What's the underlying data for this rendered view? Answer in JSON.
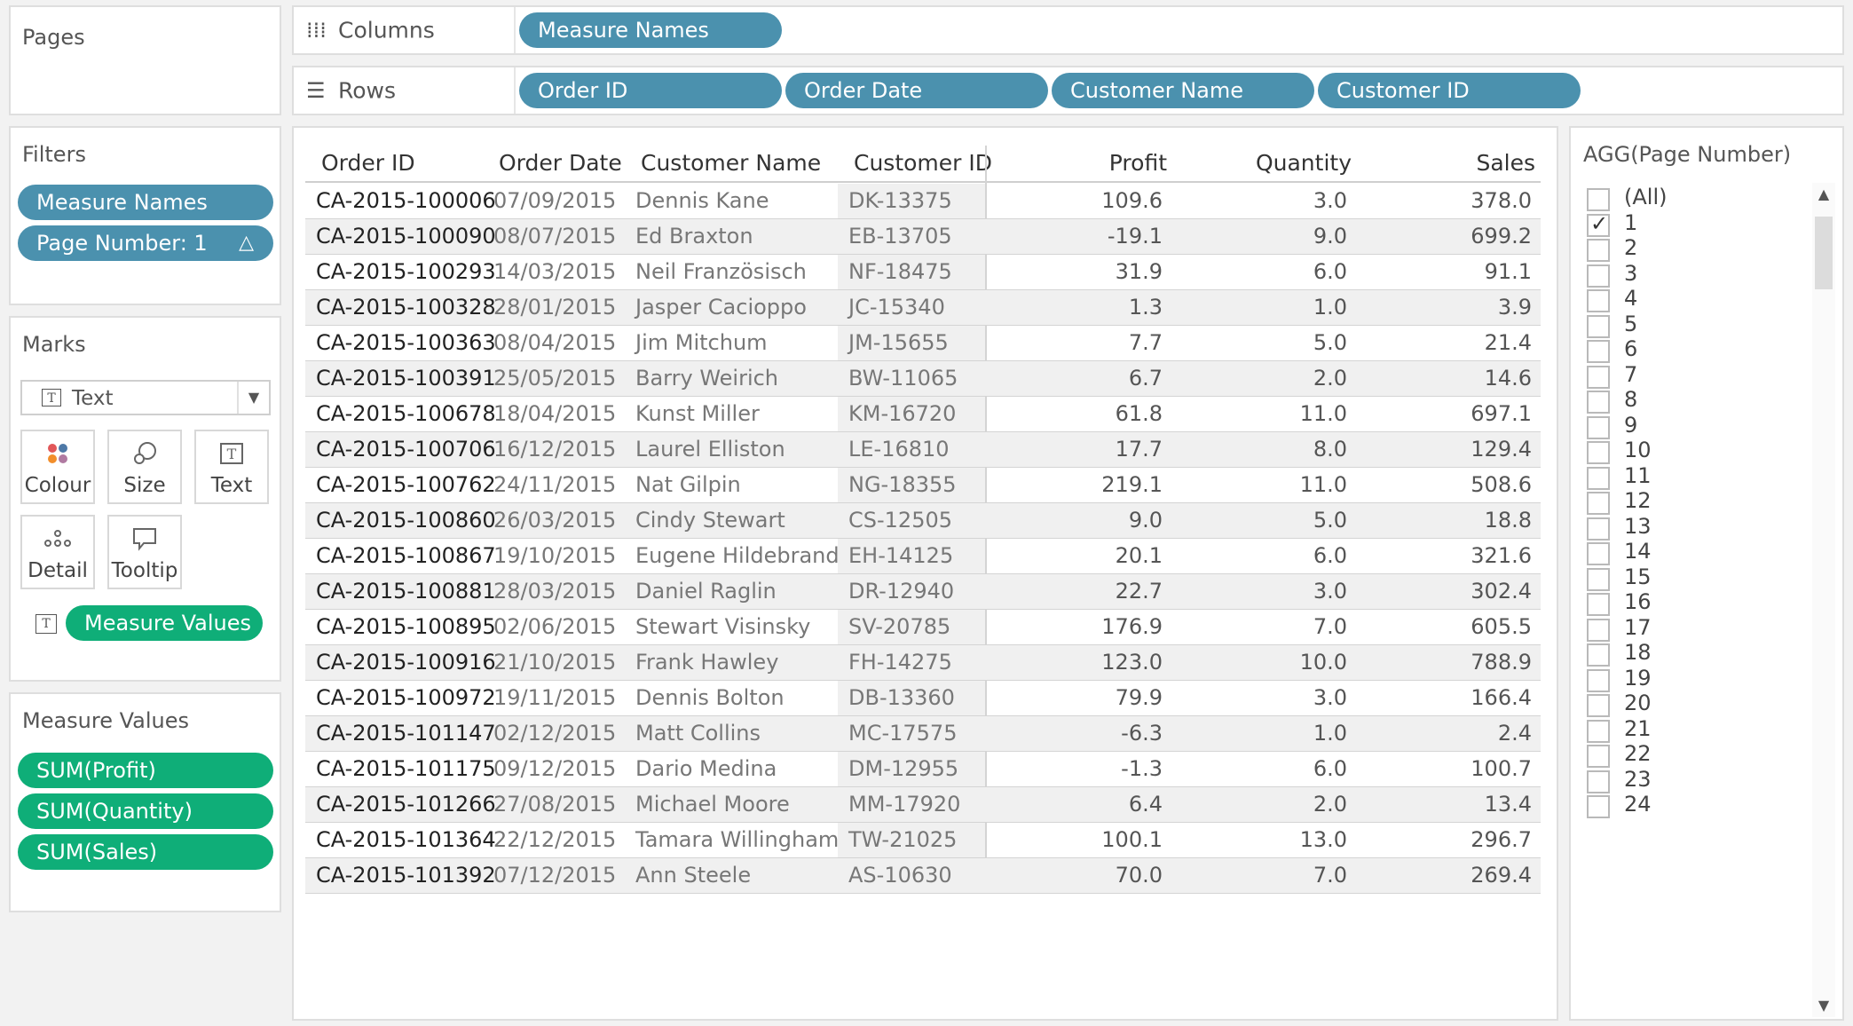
{
  "pages": {
    "title": "Pages"
  },
  "columns_shelf": {
    "label": "Columns",
    "pills": [
      "Measure Names"
    ]
  },
  "rows_shelf": {
    "label": "Rows",
    "pills": [
      "Order ID",
      "Order Date",
      "Customer Name",
      "Customer ID"
    ]
  },
  "filters": {
    "title": "Filters",
    "pills": [
      "Measure Names",
      "Page Number: 1"
    ],
    "delta_glyph": "△"
  },
  "marks": {
    "title": "Marks",
    "type": "Text",
    "buttons": {
      "colour": "Colour",
      "size": "Size",
      "text": "Text",
      "detail": "Detail",
      "tooltip": "Tooltip"
    },
    "measure_values_pill": "Measure Values"
  },
  "measure_values": {
    "title": "Measure Values",
    "pills": [
      "SUM(Profit)",
      "SUM(Quantity)",
      "SUM(Sales)"
    ]
  },
  "table": {
    "headers": {
      "order_id": "Order ID",
      "order_date": "Order Date",
      "customer_name": "Customer Name",
      "customer_id": "Customer ID",
      "profit": "Profit",
      "quantity": "Quantity",
      "sales": "Sales"
    },
    "rows": [
      {
        "order_id": "CA-2015-100006",
        "order_date": "07/09/2015",
        "customer_name": "Dennis Kane",
        "customer_id": "DK-13375",
        "profit": "109.6",
        "quantity": "3.0",
        "sales": "378.0"
      },
      {
        "order_id": "CA-2015-100090",
        "order_date": "08/07/2015",
        "customer_name": "Ed Braxton",
        "customer_id": "EB-13705",
        "profit": "-19.1",
        "quantity": "9.0",
        "sales": "699.2"
      },
      {
        "order_id": "CA-2015-100293",
        "order_date": "14/03/2015",
        "customer_name": "Neil Französisch",
        "customer_id": "NF-18475",
        "profit": "31.9",
        "quantity": "6.0",
        "sales": "91.1"
      },
      {
        "order_id": "CA-2015-100328",
        "order_date": "28/01/2015",
        "customer_name": "Jasper Cacioppo",
        "customer_id": "JC-15340",
        "profit": "1.3",
        "quantity": "1.0",
        "sales": "3.9"
      },
      {
        "order_id": "CA-2015-100363",
        "order_date": "08/04/2015",
        "customer_name": "Jim Mitchum",
        "customer_id": "JM-15655",
        "profit": "7.7",
        "quantity": "5.0",
        "sales": "21.4"
      },
      {
        "order_id": "CA-2015-100391",
        "order_date": "25/05/2015",
        "customer_name": "Barry Weirich",
        "customer_id": "BW-11065",
        "profit": "6.7",
        "quantity": "2.0",
        "sales": "14.6"
      },
      {
        "order_id": "CA-2015-100678",
        "order_date": "18/04/2015",
        "customer_name": "Kunst Miller",
        "customer_id": "KM-16720",
        "profit": "61.8",
        "quantity": "11.0",
        "sales": "697.1"
      },
      {
        "order_id": "CA-2015-100706",
        "order_date": "16/12/2015",
        "customer_name": "Laurel Elliston",
        "customer_id": "LE-16810",
        "profit": "17.7",
        "quantity": "8.0",
        "sales": "129.4"
      },
      {
        "order_id": "CA-2015-100762",
        "order_date": "24/11/2015",
        "customer_name": "Nat Gilpin",
        "customer_id": "NG-18355",
        "profit": "219.1",
        "quantity": "11.0",
        "sales": "508.6"
      },
      {
        "order_id": "CA-2015-100860",
        "order_date": "26/03/2015",
        "customer_name": "Cindy Stewart",
        "customer_id": "CS-12505",
        "profit": "9.0",
        "quantity": "5.0",
        "sales": "18.8"
      },
      {
        "order_id": "CA-2015-100867",
        "order_date": "19/10/2015",
        "customer_name": "Eugene Hildebrand",
        "customer_id": "EH-14125",
        "profit": "20.1",
        "quantity": "6.0",
        "sales": "321.6"
      },
      {
        "order_id": "CA-2015-100881",
        "order_date": "28/03/2015",
        "customer_name": "Daniel Raglin",
        "customer_id": "DR-12940",
        "profit": "22.7",
        "quantity": "3.0",
        "sales": "302.4"
      },
      {
        "order_id": "CA-2015-100895",
        "order_date": "02/06/2015",
        "customer_name": "Stewart Visinsky",
        "customer_id": "SV-20785",
        "profit": "176.9",
        "quantity": "7.0",
        "sales": "605.5"
      },
      {
        "order_id": "CA-2015-100916",
        "order_date": "21/10/2015",
        "customer_name": "Frank Hawley",
        "customer_id": "FH-14275",
        "profit": "123.0",
        "quantity": "10.0",
        "sales": "788.9"
      },
      {
        "order_id": "CA-2015-100972",
        "order_date": "19/11/2015",
        "customer_name": "Dennis Bolton",
        "customer_id": "DB-13360",
        "profit": "79.9",
        "quantity": "3.0",
        "sales": "166.4"
      },
      {
        "order_id": "CA-2015-101147",
        "order_date": "02/12/2015",
        "customer_name": "Matt Collins",
        "customer_id": "MC-17575",
        "profit": "-6.3",
        "quantity": "1.0",
        "sales": "2.4"
      },
      {
        "order_id": "CA-2015-101175",
        "order_date": "09/12/2015",
        "customer_name": "Dario Medina",
        "customer_id": "DM-12955",
        "profit": "-1.3",
        "quantity": "6.0",
        "sales": "100.7"
      },
      {
        "order_id": "CA-2015-101266",
        "order_date": "27/08/2015",
        "customer_name": "Michael Moore",
        "customer_id": "MM-17920",
        "profit": "6.4",
        "quantity": "2.0",
        "sales": "13.4"
      },
      {
        "order_id": "CA-2015-101364",
        "order_date": "22/12/2015",
        "customer_name": "Tamara Willingham",
        "customer_id": "TW-21025",
        "profit": "100.1",
        "quantity": "13.0",
        "sales": "296.7"
      },
      {
        "order_id": "CA-2015-101392",
        "order_date": "07/12/2015",
        "customer_name": "Ann Steele",
        "customer_id": "AS-10630",
        "profit": "70.0",
        "quantity": "7.0",
        "sales": "269.4"
      }
    ]
  },
  "page_filter": {
    "title": "AGG(Page Number)",
    "items": [
      "(All)",
      "1",
      "2",
      "3",
      "4",
      "5",
      "6",
      "7",
      "8",
      "9",
      "10",
      "11",
      "12",
      "13",
      "14",
      "15",
      "16",
      "17",
      "18",
      "19",
      "20",
      "21",
      "22",
      "23",
      "24"
    ],
    "checked": "1"
  },
  "colors": {
    "shelf_pill": "#4b91ae",
    "measure_pill": "#0fae78"
  }
}
